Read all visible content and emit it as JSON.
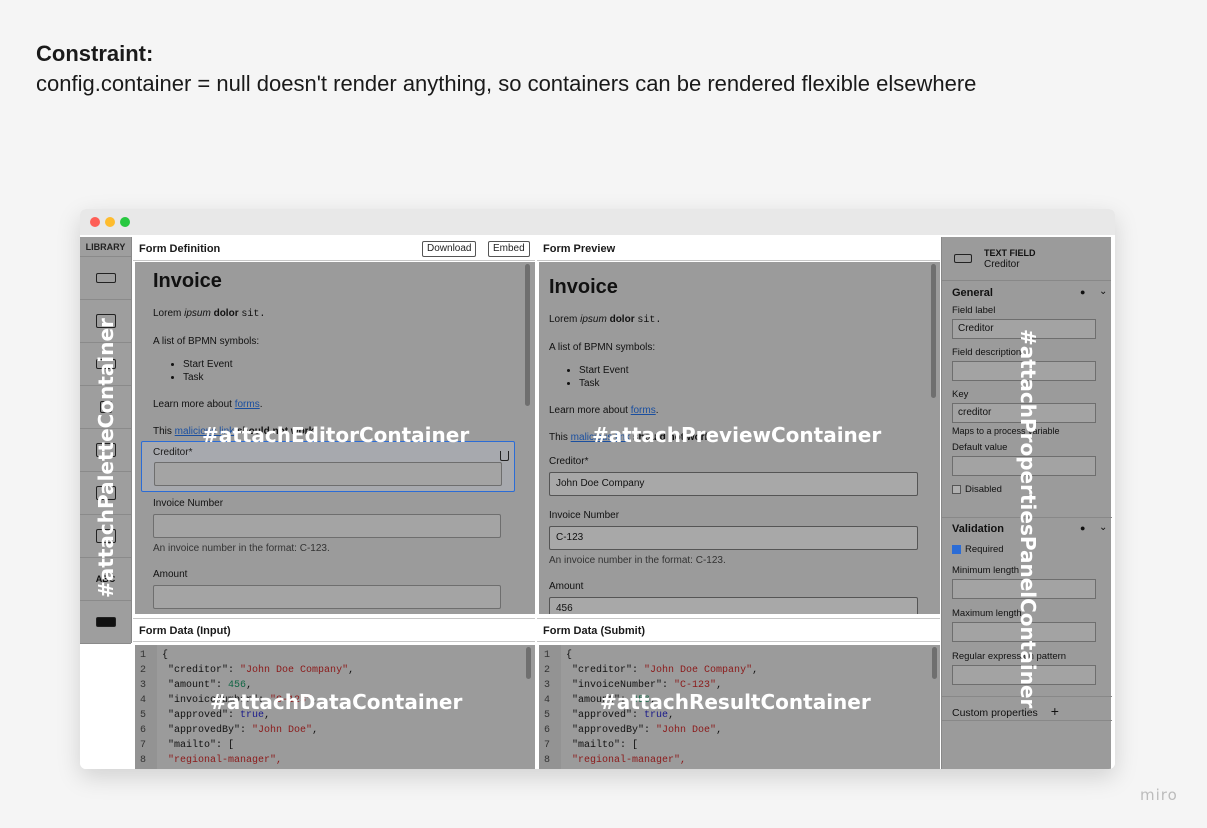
{
  "heading": {
    "title": "Constraint:",
    "text": "config.container = null doesn't render anything, so containers can be rendered flexible elsewhere"
  },
  "palette": {
    "title": "LIBRARY",
    "overlay_label": "#attachPaletteContainer",
    "items": [
      "text-field-icon",
      "textarea-icon",
      "number-icon",
      "checkbox-icon",
      "radio-icon",
      "select-icon",
      "text-view-icon",
      "button-icon"
    ],
    "abc_label": "ABC"
  },
  "editor": {
    "title": "Form Definition",
    "download_label": "Download",
    "embed_label": "Embed",
    "overlay_label": "#attachEditorContainer"
  },
  "preview": {
    "title": "Form Preview",
    "overlay_label": "#attachPreviewContainer"
  },
  "form": {
    "heading": "Invoice",
    "lorem_1": "Lorem ",
    "lorem_italic": "ipsum",
    "lorem_bold": "dolor",
    "lorem_code": "sit.",
    "list_intro": "A list of BPMN symbols:",
    "list_items": [
      "Start Event",
      "Task"
    ],
    "learn_more": "Learn more about ",
    "learn_link": "forms",
    "malicious_start": "This ",
    "malicious_link": "malicious link",
    "malicious_end": " should not work",
    "creditor_label": "Creditor*",
    "invoice_number_label": "Invoice Number",
    "invoice_hint": "An invoice number in the format: C-123.",
    "amount_label": "Amount"
  },
  "preview_values": {
    "creditor": "John Doe Company",
    "invoice_number": "C-123",
    "amount": "456"
  },
  "data_input": {
    "title": "Form Data (Input)",
    "overlay_label": "#attachDataContainer",
    "lines": [
      {
        "n": "1",
        "text": "{"
      },
      {
        "n": "2",
        "key": "\"creditor\"",
        "val": "\"John Doe Company\"",
        "type": "str"
      },
      {
        "n": "3",
        "key": "\"amount\"",
        "val": "456",
        "type": "num"
      },
      {
        "n": "4",
        "key": "\"invoiceNumber\"",
        "val": "\"C-123\"",
        "type": "str"
      },
      {
        "n": "5",
        "key": "\"approved\"",
        "val": "true",
        "type": "kw"
      },
      {
        "n": "6",
        "key": "\"approvedBy\"",
        "val": "\"John Doe\"",
        "type": "str"
      },
      {
        "n": "7",
        "key": "\"mailto\"",
        "val": "[",
        "type": "plain"
      },
      {
        "n": "8",
        "text": "  \"regional-manager\","
      }
    ]
  },
  "data_result": {
    "title": "Form Data (Submit)",
    "overlay_label": "#attachResultContainer",
    "lines": [
      {
        "n": "1",
        "text": "{"
      },
      {
        "n": "2",
        "key": "\"creditor\"",
        "val": "\"John Doe Company\"",
        "type": "str"
      },
      {
        "n": "3",
        "key": "\"invoiceNumber\"",
        "val": "\"C-123\"",
        "type": "str"
      },
      {
        "n": "4",
        "key": "\"amount\"",
        "val": "456",
        "type": "num"
      },
      {
        "n": "5",
        "key": "\"approved\"",
        "val": "true",
        "type": "kw"
      },
      {
        "n": "6",
        "key": "\"approvedBy\"",
        "val": "\"John Doe\"",
        "type": "str"
      },
      {
        "n": "7",
        "key": "\"mailto\"",
        "val": "[",
        "type": "plain"
      },
      {
        "n": "8",
        "text": "  \"regional-manager\","
      }
    ]
  },
  "properties": {
    "overlay_label": "#attachPropertiesPanelContainer",
    "type_label": "TEXT FIELD",
    "name": "Creditor",
    "general_title": "General",
    "field_label_label": "Field label",
    "field_label_value": "Creditor",
    "field_description_label": "Field description",
    "key_label": "Key",
    "key_value": "creditor",
    "key_hint": "Maps to a process variable",
    "default_value_label": "Default value",
    "disabled_label": "Disabled",
    "validation_title": "Validation",
    "required_label": "Required",
    "min_length_label": "Minimum length",
    "max_length_label": "Maximum length",
    "regex_label": "Regular expression pattern",
    "custom_props_label": "Custom properties",
    "add_symbol": "+"
  },
  "watermark": "miro"
}
